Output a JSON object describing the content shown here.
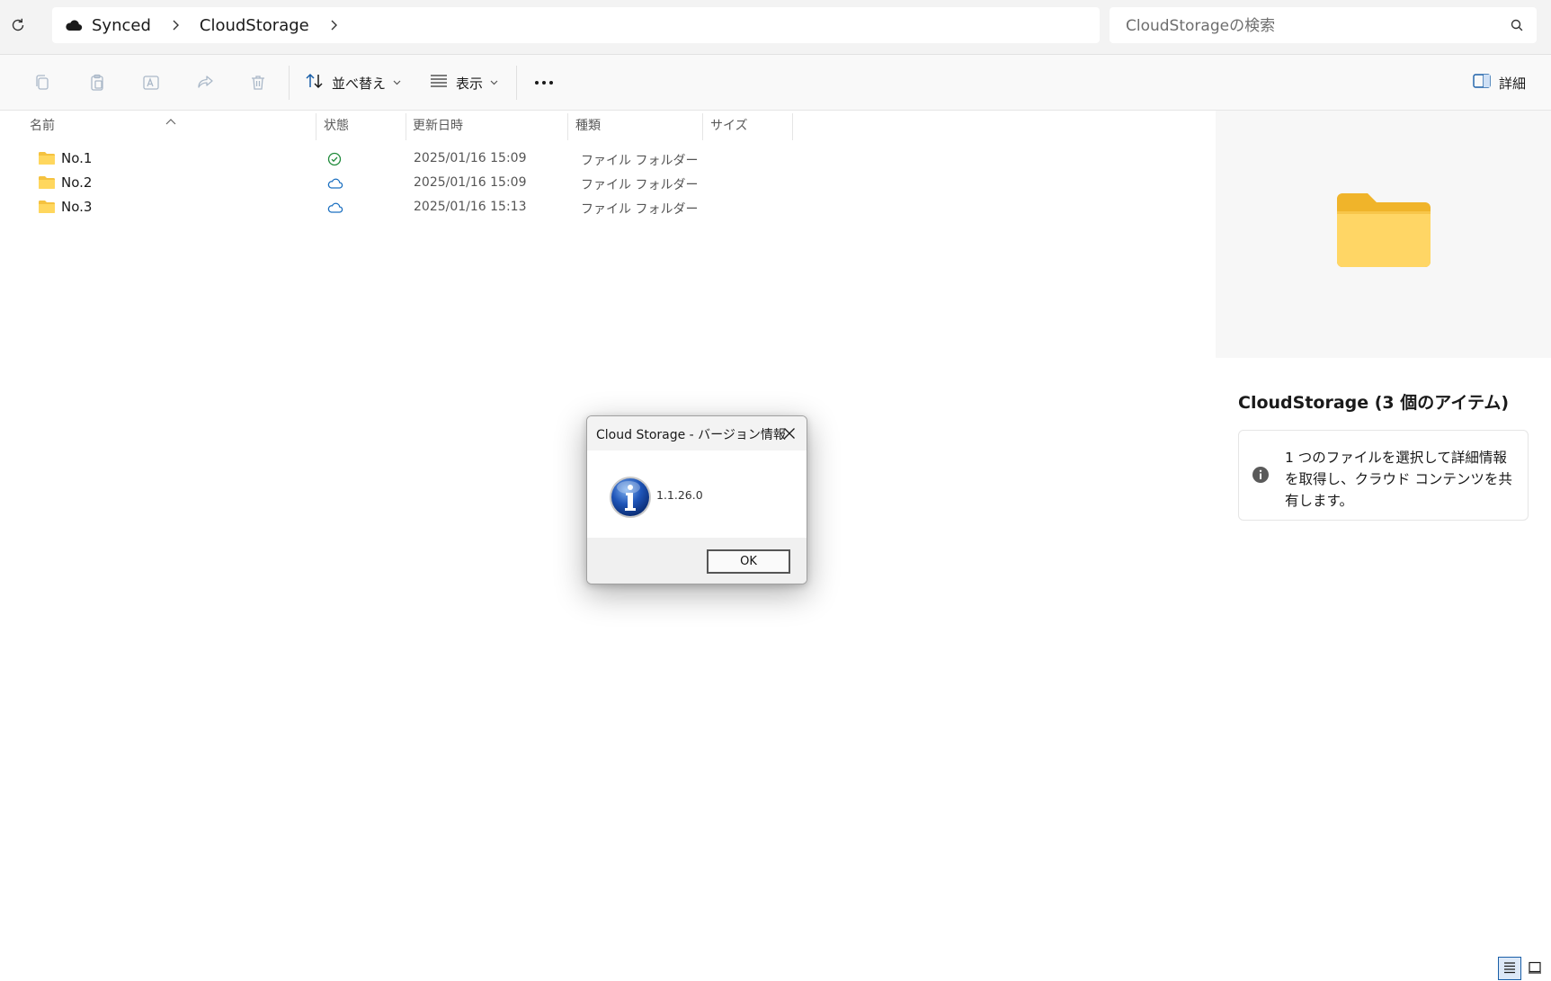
{
  "address": {
    "crumbs": [
      "Synced",
      "CloudStorage"
    ]
  },
  "search": {
    "placeholder": "CloudStorageの検索"
  },
  "toolbar": {
    "sort_label": "並べ替え",
    "view_label": "表示",
    "details_label": "詳細"
  },
  "columns": {
    "name": "名前",
    "status": "状態",
    "modified": "更新日時",
    "type": "種類",
    "size": "サイズ"
  },
  "files": [
    {
      "name": "No.1",
      "status": "synced",
      "modified": "2025/01/16 15:09",
      "type": "ファイル フォルダー"
    },
    {
      "name": "No.2",
      "status": "cloud",
      "modified": "2025/01/16 15:09",
      "type": "ファイル フォルダー"
    },
    {
      "name": "No.3",
      "status": "cloud",
      "modified": "2025/01/16 15:13",
      "type": "ファイル フォルダー"
    }
  ],
  "details": {
    "title": "CloudStorage (3 個のアイテム)",
    "info": "1 つのファイルを選択して詳細情報を取得し、クラウド コンテンツを共有します。"
  },
  "dialog": {
    "title": "Cloud Storage - バージョン情報",
    "version": "1.1.26.0",
    "ok_label": "OK"
  },
  "colors": {
    "folder": "#f5c23f",
    "synced_status": "#1f8a3a",
    "cloud_status": "#1a6fc0",
    "accent": "#0067c0"
  }
}
